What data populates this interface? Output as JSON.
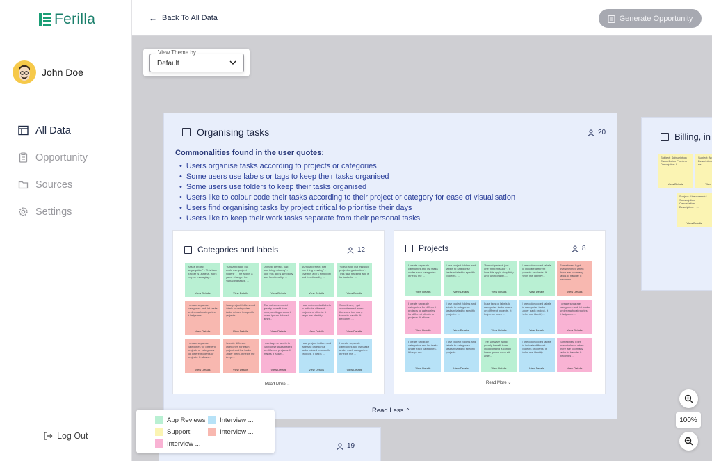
{
  "app": {
    "name": "Ferilla"
  },
  "user": {
    "name": "John Doe"
  },
  "nav": [
    {
      "label": "All Data",
      "icon": "table-icon",
      "active": true
    },
    {
      "label": "Opportunity",
      "icon": "clipboard-icon",
      "active": false
    },
    {
      "label": "Sources",
      "icon": "folder-icon",
      "active": false
    },
    {
      "label": "Settings",
      "icon": "gear-icon",
      "active": false
    }
  ],
  "logout_label": "Log Out",
  "topbar": {
    "back_label": "Back To All Data",
    "generate_label": "Generate Opportunity"
  },
  "theme": {
    "label": "View Theme by",
    "value": "Default"
  },
  "cluster": {
    "title": "Organising tasks",
    "count": "20",
    "commonalities_heading": "Commonalities found in the user quotes:",
    "commonalities": [
      "Users organise tasks according to projects or categories",
      "Some users use labels or tags to keep their tasks organised",
      "Some users use folders to keep their tasks organised",
      "Users like to colour code their tasks according to their project or category for ease of visualisation",
      "Users find organising tasks by project critical to prioritise their days",
      "Users like to keep their work tasks separate from their personal tasks"
    ],
    "read_less": "Read Less"
  },
  "subclusters": [
    {
      "title": "Categories and labels",
      "count": "12",
      "read_more": "Read More",
      "notes": [
        {
          "color": "g",
          "text": "\"tasks project segregation\" - This task tracker is useless, work req.'ne managing..."
        },
        {
          "color": "g",
          "text": "\"Amazing app, but could use project folders\" - The app is a game changer for managing tasks, ..."
        },
        {
          "color": "g",
          "text": "\"Almost perfect, just one thing missing\" - I love this app's simplicity and functionality, ..."
        },
        {
          "color": "g",
          "text": "\"Almost perfect, just one thing missing\" - I love this app's simplicity and functionality, ..."
        },
        {
          "color": "g",
          "text": "\"Great app, but missing project organization\" - This task tracking app is fantastic for ..."
        },
        {
          "color": "r",
          "text": "I create separate categories and list tasks under each categories. It helps me ..."
        },
        {
          "color": "r",
          "text": "I use project folders and labels to categorise tasks related to specific projects. ..."
        },
        {
          "color": "p",
          "text": "The software would greatly benefit from incorporating a cohort lorem ipsum dolor sit amet..."
        },
        {
          "color": "p",
          "text": "I use color-coded labels to indicate different projects or clients. It helps me identify..."
        },
        {
          "color": "p",
          "text": "Sometimes, I get overwhelmed when there are too many tasks to handle. It becomes ..."
        },
        {
          "color": "r",
          "text": "I create separate categories for different projects or categories for different clients or projects. It allows..."
        },
        {
          "color": "r",
          "text": "I create different categories for each project and list tasks under them. It helps me keep ..."
        },
        {
          "color": "p",
          "text": "I use tags or labels to categorise tasks based on different projects. It makes it easier..."
        },
        {
          "color": "b",
          "text": "I use project folders and labels to categorise tasks related to specific projects. It helps ..."
        },
        {
          "color": "b",
          "text": "I create separate categories and list tasks under each categories. It helps me ..."
        }
      ]
    },
    {
      "title": "Projects",
      "count": "8",
      "read_more": "Read More",
      "notes": [
        {
          "color": "g",
          "text": "I create separate categories and list tasks under each categories. It helps me ..."
        },
        {
          "color": "g",
          "text": "I use project folders and labels to categorise tasks related to specific projects. ..."
        },
        {
          "color": "g",
          "text": "\"Almost perfect, just one thing missing\" - I love this app's simplicity and functionality, ..."
        },
        {
          "color": "g",
          "text": "I use color-coded labels to indicate different projects or clients. It helps me identify..."
        },
        {
          "color": "r",
          "text": "Sometimes, I get overwhelmed when there are too many tasks to handle. It becomes ..."
        },
        {
          "color": "p",
          "text": "I create separate categories for different projects or categories for different clients or projects. It allows..."
        },
        {
          "color": "b",
          "text": "I use project folders and labels to categorise tasks related to specific projects. ..."
        },
        {
          "color": "b",
          "text": "I use tags or labels to categorise tasks based on different projects. It helps me keep ..."
        },
        {
          "color": "b",
          "text": "I use color-coded labels to categorise tasks under each project. It helps me identify..."
        },
        {
          "color": "p",
          "text": "I create separate categories and list tasks under each categories. It helps me ..."
        },
        {
          "color": "b",
          "text": "I create separate categories and list tasks under each categories. It helps me ..."
        },
        {
          "color": "b",
          "text": "I use project folders and labels to categorise tasks related to specific projects. ..."
        },
        {
          "color": "g",
          "text": "The software would greatly benefit from incorporating a cohort lorem ipsum dolor sit amet..."
        },
        {
          "color": "b",
          "text": "I use color-coded labels to indicate different projects or clients. It helps me identify..."
        },
        {
          "color": "p",
          "text": "Sometimes, I get overwhelmed when there are too many tasks to handle. It becomes ..."
        }
      ]
    }
  ],
  "view_details": "View Details",
  "cluster2": {
    "title": "Billing, in",
    "notes": [
      {
        "color": "y",
        "text": "Subject: Subscription Cancellation Problem Description: I ..."
      },
      {
        "color": "y",
        "text": "Subject: Access Ne... Description: I req.'re a ne..."
      },
      {
        "color": "y",
        "text": "Subject: Unsuccessful Subscription Cancellation Description: I ..."
      }
    ]
  },
  "cluster3": {
    "count": "19"
  },
  "legend": [
    {
      "label": "App Reviews",
      "color": "#b9f0d3"
    },
    {
      "label": "Interview ...",
      "color": "#b7e2f7"
    },
    {
      "label": "Support",
      "color": "#fbf4b3"
    },
    {
      "label": "Interview ...",
      "color": "#f8b8b0"
    },
    {
      "label": "Interview ...",
      "color": "#f9b3d4"
    }
  ],
  "zoom": {
    "level": "100%"
  }
}
